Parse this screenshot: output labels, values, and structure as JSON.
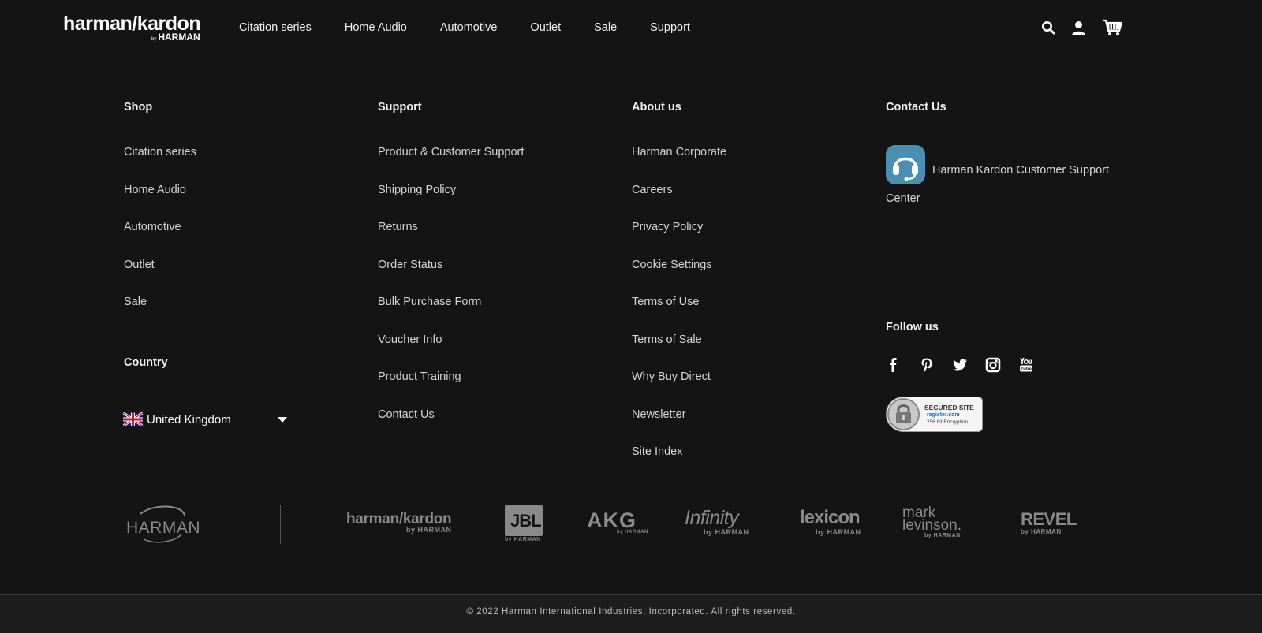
{
  "header": {
    "logo": {
      "main": "harman/kardon",
      "by": "by",
      "sub": "HARMAN"
    },
    "nav": [
      "Citation series",
      "Home Audio",
      "Automotive",
      "Outlet",
      "Sale",
      "Support"
    ],
    "icons": [
      "search-icon",
      "account-icon",
      "cart-icon"
    ]
  },
  "shop": {
    "title": "Shop",
    "links": [
      "Citation series",
      "Home Audio",
      "Automotive",
      "Outlet",
      "Sale"
    ]
  },
  "support": {
    "title": "Support",
    "links": [
      "Product & Customer Support",
      "Shipping Policy",
      "Returns",
      "Order Status",
      "Bulk Purchase Form",
      "Voucher Info",
      "Product Training",
      "Contact Us"
    ]
  },
  "about": {
    "title": "About us",
    "links": [
      "Harman Corporate",
      "Careers",
      "Privacy Policy",
      "Cookie Settings",
      "Terms of Use",
      "Terms of Sale",
      "Why Buy Direct",
      "Newsletter",
      "Site Index"
    ]
  },
  "contact": {
    "title": "Contact Us",
    "support_center": "Harman Kardon Customer Support Center"
  },
  "country": {
    "title": "Country",
    "selected": "United Kingdom",
    "flag_icon": "uk-flag-icon"
  },
  "follow": {
    "title": "Follow us",
    "icons": [
      "facebook-icon",
      "pinterest-icon",
      "twitter-icon",
      "instagram-icon",
      "youtube-icon"
    ]
  },
  "secured_badge": {
    "line1": "SECURED SITE",
    "line2": "register.com",
    "line3": "256 bit Encryption"
  },
  "brands": {
    "harman": "HARMAN",
    "harman_kardon": "harman/kardon",
    "jbl": "JBL",
    "akg": "AKG",
    "infinity": "Infinity",
    "lexicon": "lexicon",
    "mark_levinson_1": "mark",
    "mark_levinson_2": "levinson.",
    "revel": "REVEL",
    "by_harman": "by HARMAN"
  },
  "footer": {
    "copyright": "© 2022 Harman International Industries, Incorporated. All rights reserved."
  },
  "colors": {
    "background": "#141414",
    "text": "#d9d9d9",
    "headset_blue": "#4a8fb3",
    "brand_grey": "#8a8a8a"
  }
}
